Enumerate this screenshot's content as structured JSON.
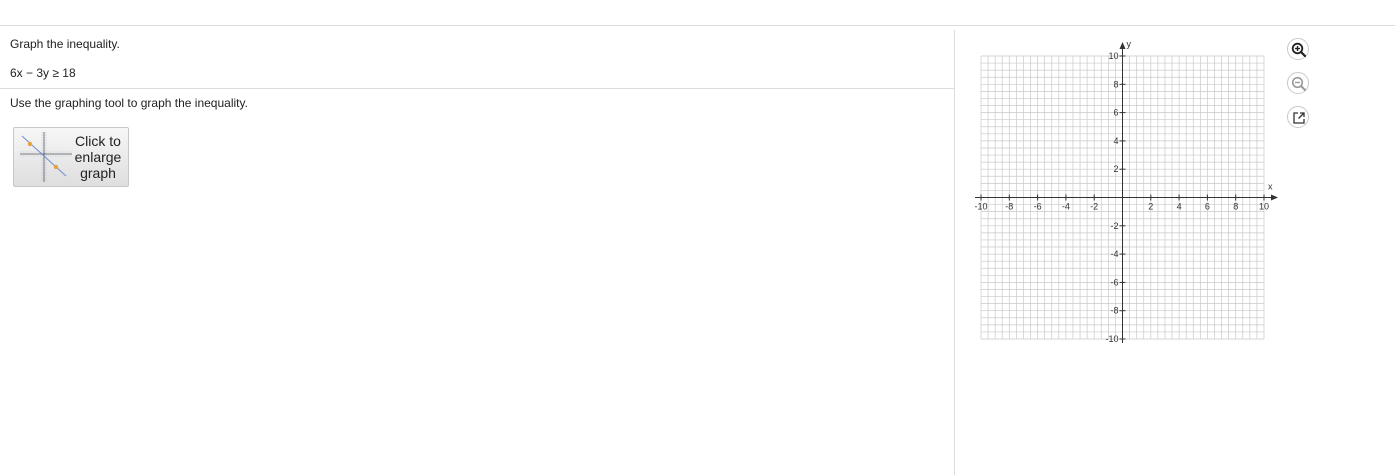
{
  "question": {
    "instruction": "Graph the inequality.",
    "inequality": "6x − 3y ≥ 18",
    "tool_instruction": "Use the graphing tool to graph the inequality."
  },
  "enlarge_button": {
    "line1": "Click to",
    "line2": "enlarge",
    "line3": "graph"
  },
  "graph": {
    "x_axis_label": "x",
    "y_axis_label": "y",
    "x_range": [
      -10,
      10
    ],
    "y_range": [
      -10,
      10
    ],
    "x_tick_labels": [
      "-10",
      "-8",
      "-6",
      "-4",
      "-2",
      "2",
      "4",
      "6",
      "8",
      "10"
    ],
    "y_tick_labels": [
      "10",
      "8",
      "6",
      "4",
      "2",
      "-2",
      "-4",
      "-6",
      "-8",
      "-10"
    ],
    "grid_minor_step": 0.5,
    "grid": true
  },
  "toolbar": {
    "zoom_in_icon": "zoom-in-icon",
    "zoom_out_icon": "zoom-out-icon",
    "popout_icon": "popout-icon"
  },
  "colors": {
    "grid": "#c9c9c9",
    "axis": "#333333",
    "icon_active": "#1f1f1f",
    "icon_muted": "#9a9a9a"
  }
}
